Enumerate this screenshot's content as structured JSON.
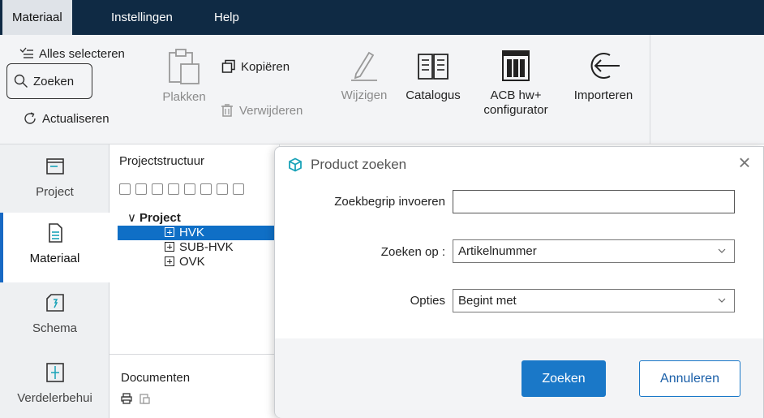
{
  "menubar": {
    "items": [
      "Materiaal",
      "Instellingen",
      "Help"
    ]
  },
  "ribbon": {
    "select_all": "Alles selecteren",
    "search": "Zoeken",
    "refresh": "Actualiseren",
    "paste": "Plakken",
    "copy": "Kopiëren",
    "delete": "Verwijderen",
    "edit": "Wijzigen",
    "catalog": "Catalogus",
    "acb_line1": "ACB hw+",
    "acb_line2": "configurator",
    "import": "Importeren"
  },
  "leftnav": {
    "items": [
      "Project",
      "Materiaal",
      "Schema",
      "Verdelerbehui"
    ],
    "active": "Materiaal"
  },
  "panel": {
    "title": "Projectstructuur",
    "tree": {
      "root": "Project",
      "children": [
        "HVK",
        "SUB-HVK",
        "OVK"
      ],
      "selected": "HVK"
    },
    "documents_title": "Documenten"
  },
  "dialog": {
    "title": "Product zoeken",
    "search_term_label": "Zoekbegrip invoeren",
    "search_term_value": "",
    "search_on_label": "Zoeken op :",
    "search_on_value": "Artikelnummer",
    "options_label": "Opties",
    "options_value": "Begint met",
    "submit_label": "Zoeken",
    "cancel_label": "Annuleren"
  },
  "colors": {
    "menubar_bg": "#0f2a44",
    "accent": "#1a78c8",
    "selection": "#0f6fc6",
    "icon_teal": "#1aa3b8"
  }
}
